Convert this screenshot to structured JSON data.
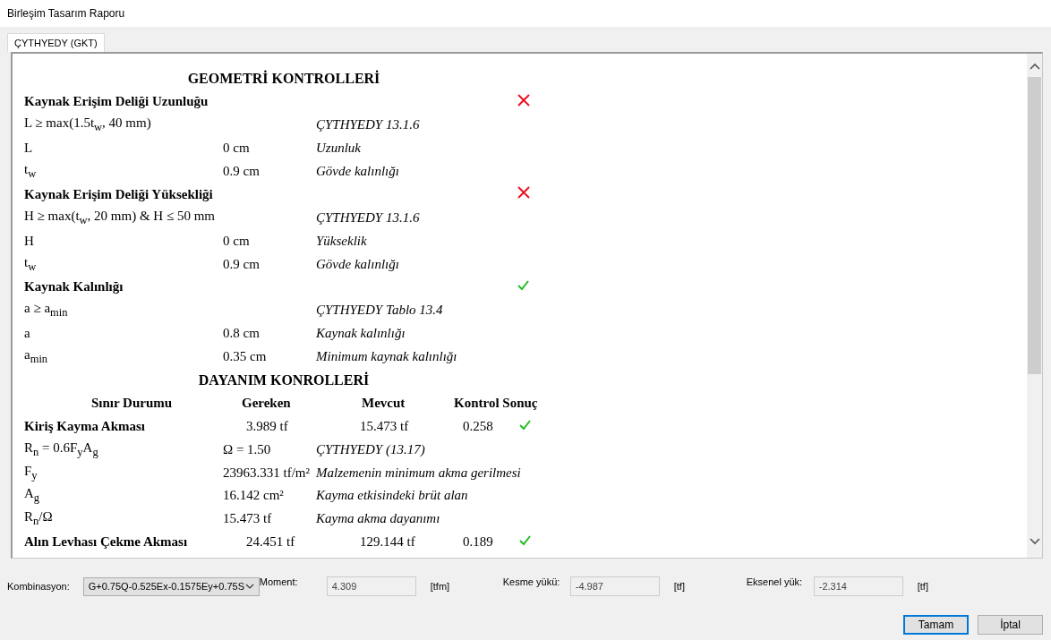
{
  "window": {
    "title": "Birleşim Tasarım Raporu"
  },
  "tabs": [
    {
      "label": "ÇYTHYEDY (GKT)",
      "selected": true
    }
  ],
  "report": [
    {
      "kind": "heading",
      "text": "GEOMETRİ KONTROLLERİ"
    },
    {
      "kind": "section",
      "name": "Kaynak Erişim Deliği Uzunluğu",
      "passed": false
    },
    {
      "kind": "line",
      "label": "L ≥ max(1.5t$_{w}$, 40 mm)",
      "note": "ÇYTHYEDY 13.1.6"
    },
    {
      "kind": "line",
      "label": "L",
      "value": "0 cm",
      "note": "Uzunluk"
    },
    {
      "kind": "line",
      "label": "t$_{w}$",
      "value": "0.9 cm",
      "note": "Gövde kalınlığı"
    },
    {
      "kind": "section",
      "name": "Kaynak Erişim Deliği Yüksekliği",
      "passed": false
    },
    {
      "kind": "line",
      "label": "H ≥ max(t$_{w}$, 20 mm) & H ≤ 50 mm",
      "note": "ÇYTHYEDY 13.1.6"
    },
    {
      "kind": "line",
      "label": "H",
      "value": "0 cm",
      "note": "Yükseklik"
    },
    {
      "kind": "line",
      "label": "t$_{w}$",
      "value": "0.9 cm",
      "note": "Gövde kalınlığı"
    },
    {
      "kind": "section",
      "name": "Kaynak Kalınlığı",
      "passed": true
    },
    {
      "kind": "line",
      "label": "a ≥ a$_{min}$",
      "note": "ÇYTHYEDY Tablo 13.4"
    },
    {
      "kind": "line",
      "label": "a",
      "value": "0.8 cm",
      "note": "Kaynak kalınlığı"
    },
    {
      "kind": "line",
      "label": "a$_{min}$",
      "value": "0.35 cm",
      "note": "Minimum kaynak kalınlığı"
    },
    {
      "kind": "heading",
      "text": "DAYANIM KONROLLERİ"
    },
    {
      "kind": "table_header",
      "columns": [
        "Sınır Durumu",
        "Gereken",
        "Mevcut",
        "Kontrol Sonuç"
      ]
    },
    {
      "kind": "check",
      "name": "Kiriş Kayma Akması",
      "required": "3.989 tf",
      "available": "15.473 tf",
      "ratio": "0.258",
      "passed": true
    },
    {
      "kind": "line",
      "label": "R$_{n}$ = 0.6F$_{y}$A$_{g}$",
      "value": "Ω = 1.50",
      "note": "ÇYTHYEDY (13.17)"
    },
    {
      "kind": "line",
      "label": "F$_{y}$",
      "value": "23963.331 tf/m²",
      "note": "Malzemenin minimum akma gerilmesi"
    },
    {
      "kind": "line",
      "label": "A$_{g}$",
      "value": "16.142 cm²",
      "note": "Kayma etkisindeki brüt alan"
    },
    {
      "kind": "line",
      "label": "R$_{n}$/Ω",
      "value": "15.473 tf",
      "note": "Kayma akma dayanımı"
    },
    {
      "kind": "check",
      "name": "Alın Levhası Çekme Akması",
      "required": "24.451 tf",
      "available": "129.144 tf",
      "ratio": "0.189",
      "passed": true
    }
  ],
  "combination": {
    "label": "Kombinasyon:",
    "value": "G+0.75Q-0.525Ex-0.1575Ey+0.75S"
  },
  "fields": [
    {
      "label": "Moment:",
      "value": "4.309",
      "unit": "[tfm]",
      "disabled": true
    },
    {
      "label": "Kesme yükü:",
      "value": "-4.987",
      "unit": "[tf]",
      "disabled": true
    },
    {
      "label": "Eksenel yük:",
      "value": "-2.314",
      "unit": "[tf]",
      "disabled": true
    }
  ],
  "buttons": [
    {
      "label": "Tamam",
      "default": true
    },
    {
      "label": "İptal",
      "default": false
    }
  ]
}
